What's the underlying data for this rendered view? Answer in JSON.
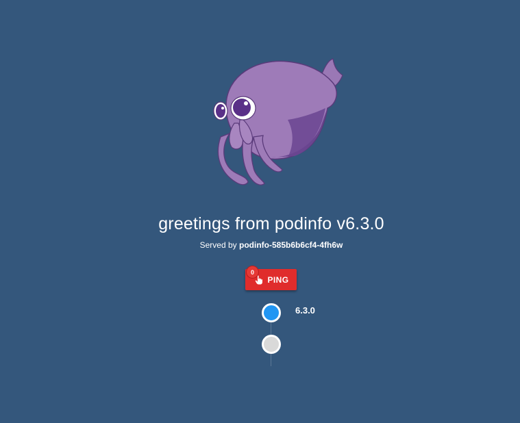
{
  "header": {
    "title": "greetings from podinfo v6.3.0",
    "served_prefix": "Served by",
    "pod_name": "podinfo-585b6b6cf4-4fh6w"
  },
  "ping": {
    "label": "PING",
    "count": "0",
    "icon": "hand-pointer-icon",
    "color": "#e02c2c"
  },
  "timeline": {
    "items": [
      {
        "label": "6.3.0",
        "color": "#2196f3"
      },
      {
        "label": "",
        "color": "#d9d9d9"
      }
    ]
  },
  "theme": {
    "background": "#34577c",
    "mascot": "cuddle-fish-icon"
  }
}
